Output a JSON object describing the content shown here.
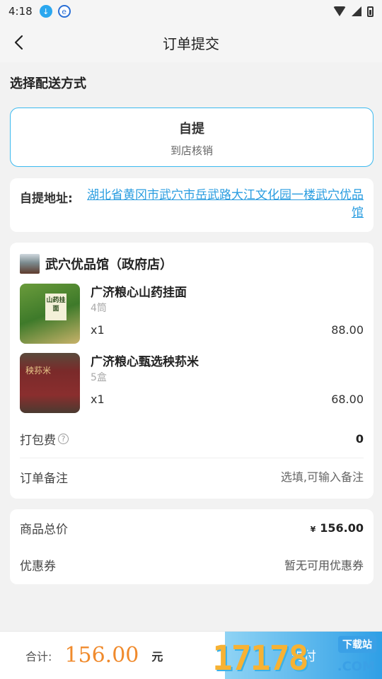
{
  "status_bar": {
    "time": "4:18"
  },
  "nav": {
    "title": "订单提交"
  },
  "delivery": {
    "section_label": "选择配送方式",
    "method_title": "自提",
    "method_sub": "到店核销"
  },
  "address": {
    "label": "自提地址:",
    "value": "湖北省黄冈市武穴市岳武路大江文化园一楼武穴优品馆"
  },
  "shop": {
    "name": "武穴优品馆（政府店）",
    "items": [
      {
        "name": "广济粮心山药挂面",
        "spec": "4筒",
        "qty": "x1",
        "price": "88.00",
        "thumb_text": "山药挂面"
      },
      {
        "name": "广济粮心甄选秧荪米",
        "spec": "5盒",
        "qty": "x1",
        "price": "68.00",
        "thumb_text": "秧荪米"
      }
    ],
    "packing_label": "打包费",
    "packing_help": "?",
    "packing_value": "0",
    "remark_label": "订单备注",
    "remark_placeholder": "选填,可输入备注"
  },
  "summary": {
    "goods_total_label": "商品总价",
    "currency": "¥",
    "goods_total_value": "156.00",
    "coupon_label": "优惠券",
    "coupon_value": "暂无可用优惠券"
  },
  "bottom": {
    "total_label": "合计:",
    "total_amount": "156.00",
    "total_unit": "元",
    "pay_label": "支付"
  },
  "watermark": {
    "digits": "17178",
    "site": "下载站",
    "domain": ".COM"
  },
  "colors": {
    "accent": "#3bb9ef",
    "price": "#f08a2c",
    "link": "#2a9de0"
  }
}
